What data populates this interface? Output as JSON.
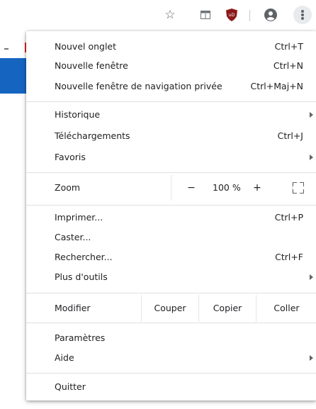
{
  "toolbar": {
    "icons": [
      "star-icon",
      "reading-list-icon",
      "ublock-shield-icon",
      "profile-icon",
      "more-menu-icon"
    ]
  },
  "menu": {
    "group1": [
      {
        "label": "Nouvel onglet",
        "shortcut": "Ctrl+T"
      },
      {
        "label": "Nouvelle fenêtre",
        "shortcut": "Ctrl+N"
      },
      {
        "label": "Nouvelle fenêtre de navigation privée",
        "shortcut": "Ctrl+Maj+N"
      }
    ],
    "group2": [
      {
        "label": "Historique",
        "has_submenu": true
      },
      {
        "label": "Téléchargements",
        "shortcut": "Ctrl+J"
      },
      {
        "label": "Favoris",
        "has_submenu": true
      }
    ],
    "zoom": {
      "label": "Zoom",
      "minus": "−",
      "value": "100 %",
      "plus": "+"
    },
    "group3": [
      {
        "label": "Imprimer...",
        "shortcut": "Ctrl+P"
      },
      {
        "label": "Caster..."
      },
      {
        "label": "Rechercher...",
        "shortcut": "Ctrl+F"
      },
      {
        "label": "Plus d'outils",
        "has_submenu": true
      }
    ],
    "edit": {
      "label": "Modifier",
      "cut": "Couper",
      "copy": "Copier",
      "paste": "Coller"
    },
    "group4": [
      {
        "label": "Paramètres"
      },
      {
        "label": "Aide",
        "has_submenu": true
      }
    ],
    "quit": {
      "label": "Quitter"
    }
  }
}
